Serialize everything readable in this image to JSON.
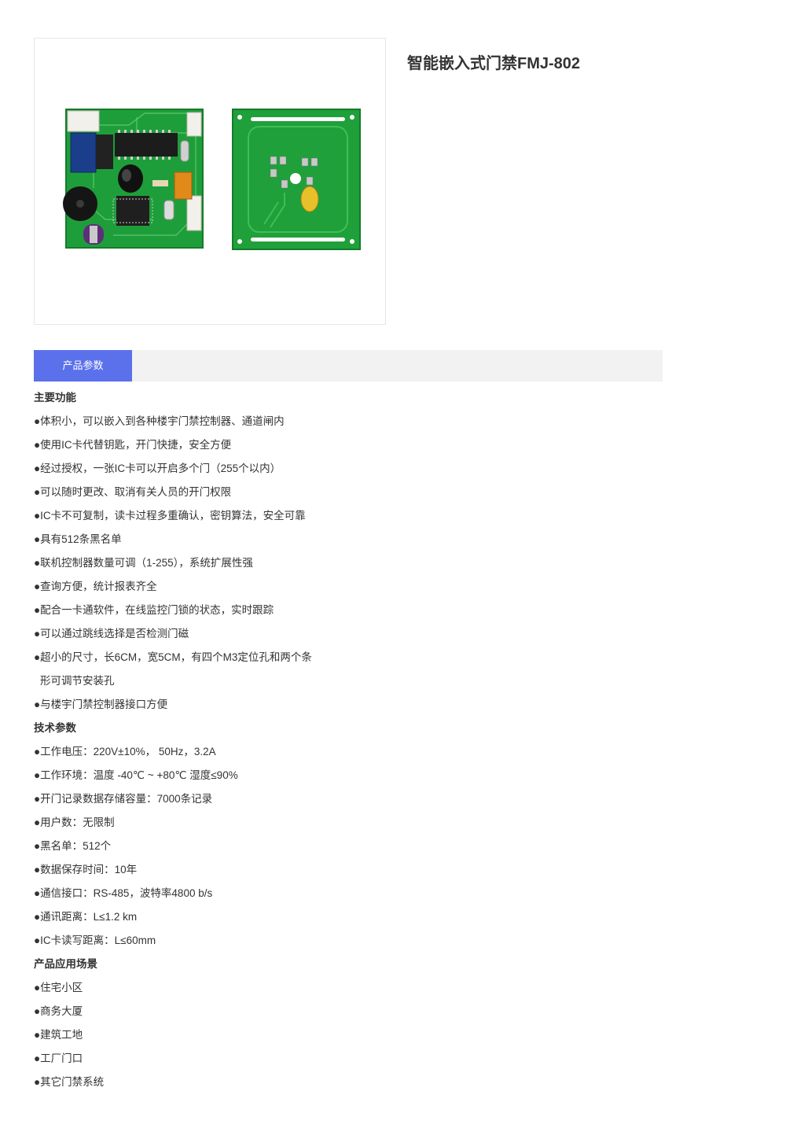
{
  "product": {
    "title": "智能嵌入式门禁FMJ-802",
    "image_alt": "门禁控制板与读卡天线板"
  },
  "tabs": [
    {
      "label": "产品参数",
      "active": true
    }
  ],
  "colors": {
    "tab_active": "#5b71ec",
    "tabbar_bg": "#f2f2f2",
    "pcb_green": "#1e9e3a"
  },
  "content": {
    "lines": [
      {
        "type": "heading",
        "text": "主要功能"
      },
      {
        "type": "item",
        "text": "●体积小，可以嵌入到各种楼宇门禁控制器、通道闸内"
      },
      {
        "type": "item",
        "text": "●使用IC卡代替钥匙，开门快捷，安全方便"
      },
      {
        "type": "item",
        "text": "●经过授权，一张IC卡可以开启多个门（255个以内）"
      },
      {
        "type": "item",
        "text": "●可以随时更改、取消有关人员的开门权限"
      },
      {
        "type": "item",
        "text": "●IC卡不可复制，读卡过程多重确认，密钥算法，安全可靠"
      },
      {
        "type": "item",
        "text": "●具有512条黑名单"
      },
      {
        "type": "item",
        "text": "●联机控制器数量可调（1-255），系统扩展性强"
      },
      {
        "type": "item",
        "text": "●查询方便，统计报表齐全"
      },
      {
        "type": "item",
        "text": "●配合一卡通软件，在线监控门锁的状态，实时跟踪"
      },
      {
        "type": "item",
        "text": "●可以通过跳线选择是否检测门磁"
      },
      {
        "type": "item",
        "text": "●超小的尺寸，长6CM，宽5CM，有四个M3定位孔和两个条"
      },
      {
        "type": "indent",
        "text": "形可调节安装孔"
      },
      {
        "type": "item",
        "text": "●与楼宇门禁控制器接口方便"
      },
      {
        "type": "heading",
        "text": "技术参数"
      },
      {
        "type": "item",
        "text": "●工作电压：220V±10%， 50Hz，3.2A"
      },
      {
        "type": "item",
        "text": "●工作环境：温度 -40℃ ~ +80℃ 湿度≤90%"
      },
      {
        "type": "item",
        "text": "●开门记录数据存储容量：7000条记录"
      },
      {
        "type": "item",
        "text": "●用户数：无限制"
      },
      {
        "type": "item",
        "text": "●黑名单：512个"
      },
      {
        "type": "item",
        "text": "●数据保存时间：10年"
      },
      {
        "type": "item",
        "text": "●通信接口：RS-485，波特率4800 b/s"
      },
      {
        "type": "item",
        "text": "●通讯距离：L≤1.2 km"
      },
      {
        "type": "item",
        "text": "●IC卡读写距离：L≤60mm"
      },
      {
        "type": "heading",
        "text": "产品应用场景"
      },
      {
        "type": "item",
        "text": "●住宅小区"
      },
      {
        "type": "item",
        "text": "●商务大厦"
      },
      {
        "type": "item",
        "text": "●建筑工地"
      },
      {
        "type": "item",
        "text": "●工厂门口"
      },
      {
        "type": "item",
        "text": "●其它门禁系统"
      }
    ]
  }
}
